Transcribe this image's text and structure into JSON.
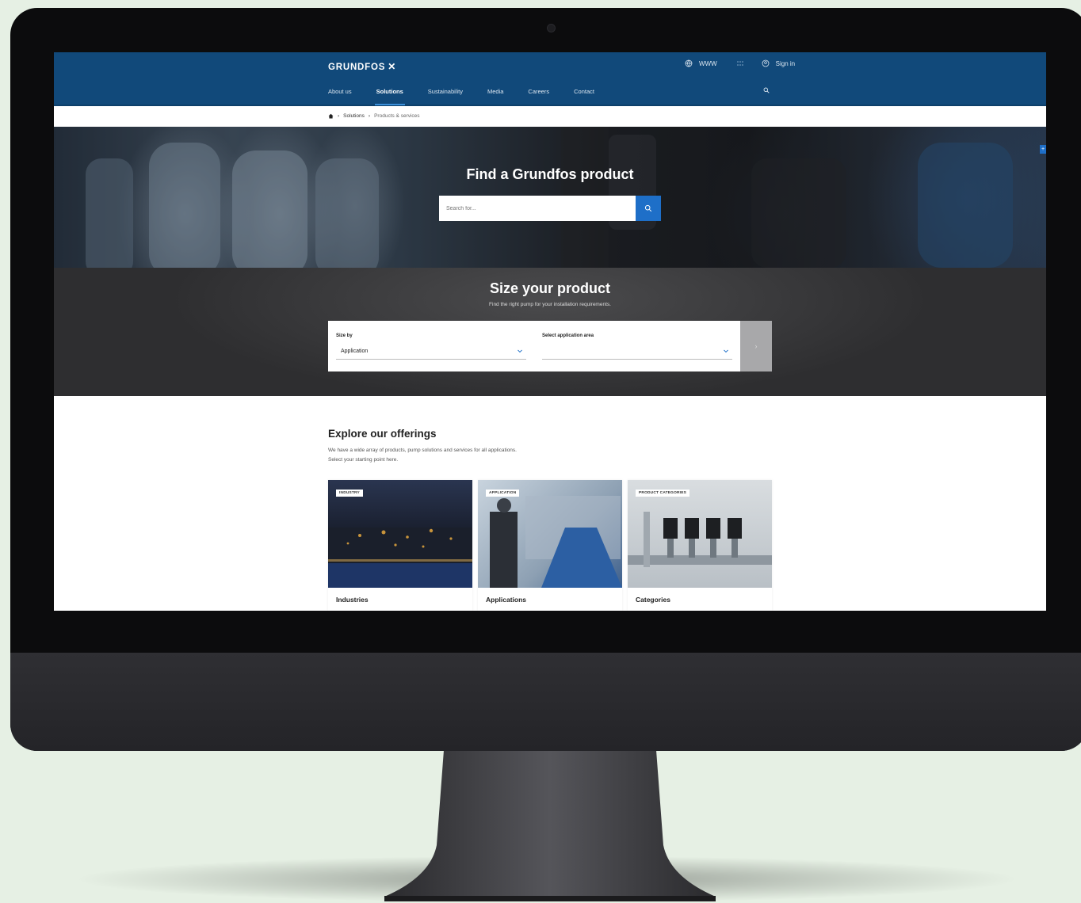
{
  "topbar": {
    "logo": "GRUNDFOS",
    "region": "WWW",
    "sign_in": "Sign in"
  },
  "nav": {
    "items": [
      "About us",
      "Solutions",
      "Sustainability",
      "Media",
      "Careers",
      "Contact"
    ],
    "active": "Solutions"
  },
  "breadcrumb": {
    "items": [
      "Solutions",
      "Products & services"
    ]
  },
  "hero": {
    "title": "Find a Grundfos product",
    "search_placeholder": "Search for..."
  },
  "size": {
    "title": "Size your product",
    "subtitle": "Find the right pump for your installation requirements.",
    "size_by_label": "Size by",
    "size_by_value": "Application",
    "area_label": "Select application area",
    "area_value": ""
  },
  "explore": {
    "title": "Explore our offerings",
    "desc_line1": "We have a wide array of products, pump solutions and services for all applications.",
    "desc_line2": "Select your starting point here.",
    "cards": [
      {
        "badge": "INDUSTRY",
        "title": "Industries"
      },
      {
        "badge": "APPLICATION",
        "title": "Applications"
      },
      {
        "badge": "PRODUCT CATEGORIES",
        "title": "Categories"
      }
    ]
  },
  "colors": {
    "brand_blue": "#11497a",
    "accent_blue": "#1e6fc8",
    "background": "#e6f0e4"
  }
}
